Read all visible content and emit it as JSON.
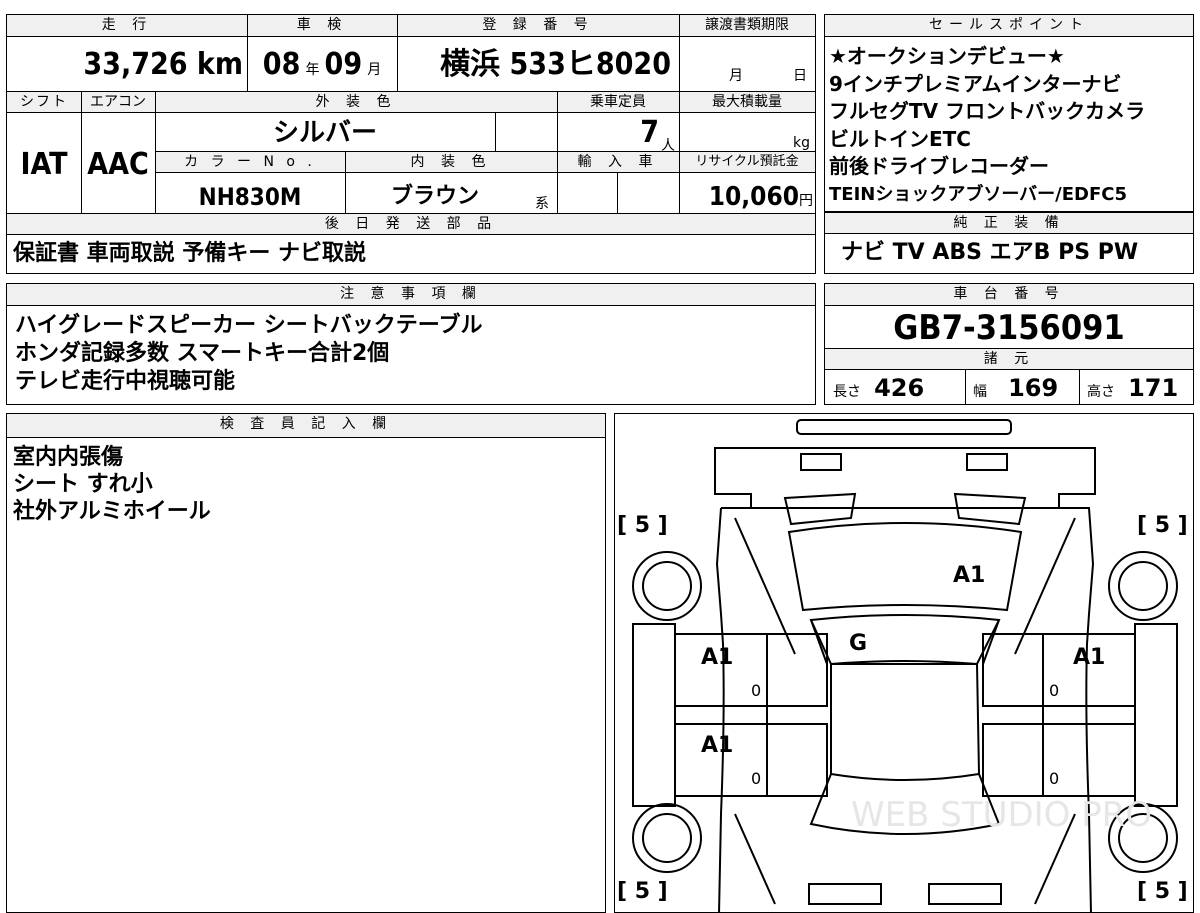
{
  "top_left": {
    "headers": {
      "mileage": "走 行",
      "inspection": "車 検",
      "registration": "登 録 番 号",
      "deadline": "譲渡書類期限"
    },
    "mileage_value": "33,726 km",
    "inspection": {
      "year": "08",
      "year_unit": "年",
      "month": "09",
      "month_unit": "月"
    },
    "registration_value": "横浜 533ヒ8020",
    "deadline": {
      "month_unit": "月",
      "day_unit": "日"
    },
    "headers2": {
      "shift": "シフト",
      "aircon": "エアコン",
      "exterior_color": "外 装 色",
      "capacity": "乗車定員",
      "max_load": "最大積載量"
    },
    "exterior_color_value": "シルバー",
    "capacity_value": "7",
    "capacity_unit": "人",
    "max_load_unit": "kg",
    "shift_value": "IAT",
    "aircon_value": "AAC",
    "headers3": {
      "color_no": "カ ラ ー N o .",
      "interior_color": "内 装 色",
      "import": "輸 入 車",
      "recycle": "リサイクル預託金"
    },
    "color_no_value": "NH830M",
    "interior_color_value": "ブラウン",
    "interior_suffix": "系",
    "recycle_value": "10,060",
    "recycle_unit": "円",
    "later_parts_header": "後 日 発 送 部 品",
    "later_parts_value": "保証書 車両取説 予備キー ナビ取説"
  },
  "sales_points": {
    "header": "セールスポイント",
    "lines": [
      "★オークションデビュー★",
      "9インチプレミアムインターナビ",
      "フルセグTV フロントバックカメラ",
      "ビルトインETC",
      "前後ドライブレコーダー",
      "TEINショックアブソーバー/EDFC5"
    ]
  },
  "genuine_equipment": {
    "header": "純 正 装 備",
    "value": "ナビ TV ABS エアB PS PW"
  },
  "notes": {
    "header": "注 意 事 項 欄",
    "lines": [
      "ハイグレードスピーカー シートバックテーブル",
      "ホンダ記録多数 スマートキー合計2個",
      "テレビ走行中視聴可能"
    ]
  },
  "chassis": {
    "header": "車 台 番 号",
    "value": "GB7-3156091"
  },
  "specs": {
    "header": "諸 元",
    "length_label": "長さ",
    "length_value": "426",
    "width_label": "幅",
    "width_value": "169",
    "height_label": "高さ",
    "height_value": "171"
  },
  "inspector": {
    "header": "検 査 員 記 入 欄",
    "lines": [
      "室内内張傷",
      "シート すれ小",
      "社外アルミホイール"
    ]
  },
  "diagram": {
    "tire_labels": [
      "[ 5 ]",
      "[ 5 ]",
      "[ 5 ]",
      "[ 5 ]"
    ],
    "damage_marks": {
      "hood": "A1",
      "windshield": "G",
      "left_front_door": "A1",
      "right_front_door": "A1",
      "left_rear_door": "A1"
    },
    "zero_marks": [
      "0",
      "0",
      "0",
      "0"
    ],
    "watermark": "WEB STUDIO PRO"
  }
}
